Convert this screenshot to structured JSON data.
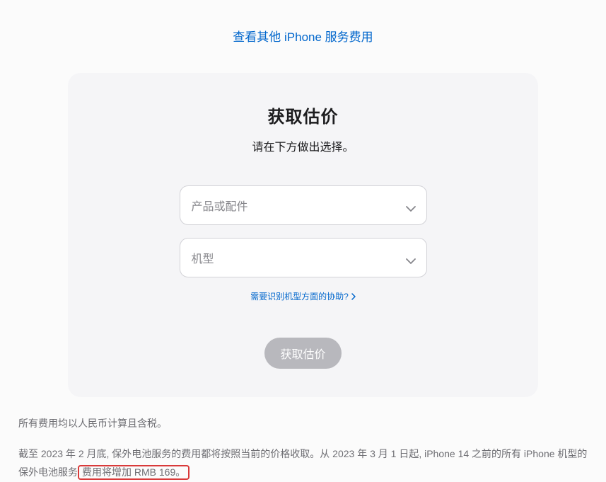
{
  "topLink": "查看其他 iPhone 服务费用",
  "card": {
    "title": "获取估价",
    "subtitle": "请在下方做出选择。",
    "select1": "产品或配件",
    "select2": "机型",
    "helpLink": "需要识别机型方面的协助?",
    "submitBtn": "获取估价"
  },
  "footer": {
    "p1": "所有费用均以人民币计算且含税。",
    "p2_part1": "截至 2023 年 2 月底, 保外电池服务的费用都将按照当前的价格收取。从 2023 年 3 月 1 日起, iPhone 14 之前的所有 iPhone 机型的保外电池服务",
    "p2_highlight": "费用将增加 RMB 169。"
  }
}
